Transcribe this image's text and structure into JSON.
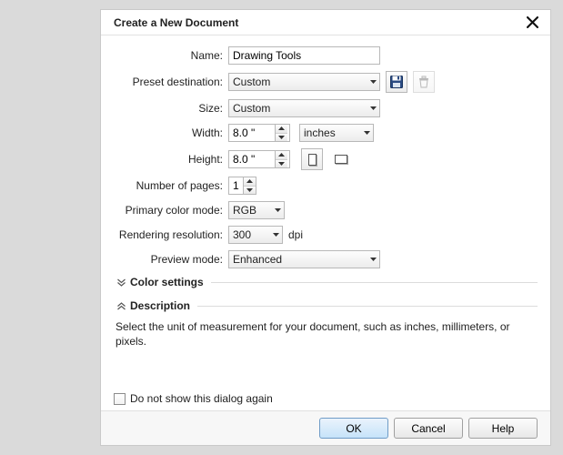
{
  "title": "Create a New Document",
  "labels": {
    "name": "Name:",
    "preset": "Preset destination:",
    "size": "Size:",
    "width": "Width:",
    "height": "Height:",
    "pages": "Number of pages:",
    "colormode": "Primary color mode:",
    "resolution": "Rendering resolution:",
    "preview": "Preview mode:",
    "dpi": "dpi"
  },
  "values": {
    "name": "Drawing Tools",
    "preset": "Custom",
    "size": "Custom",
    "width": "8.0 \"",
    "height": "8.0 \"",
    "units": "inches",
    "pages": "1",
    "colormode": "RGB",
    "resolution": "300",
    "preview": "Enhanced"
  },
  "sections": {
    "color": "Color settings",
    "description": "Description",
    "descText": "Select the unit of measurement for your document, such as inches, millimeters, or pixels."
  },
  "checkbox": "Do not show this dialog again",
  "buttons": {
    "ok": "OK",
    "cancel": "Cancel",
    "help": "Help"
  }
}
